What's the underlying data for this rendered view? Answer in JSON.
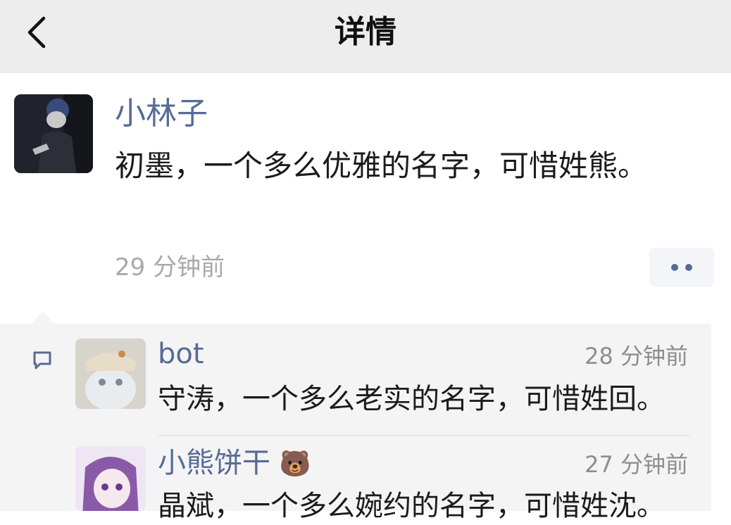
{
  "navbar": {
    "title": "详情"
  },
  "post": {
    "author": "小林子",
    "text": "初墨，一个多么优雅的名字，可惜姓熊。",
    "time": "29 分钟前"
  },
  "comments": [
    {
      "author": "bot",
      "time": "28 分钟前",
      "text": "守涛，一个多么老实的名字，可惜姓回。"
    },
    {
      "author": "小熊饼干",
      "emoji": "🐻",
      "time": "27 分钟前",
      "text": "晶斌，一个多么婉约的名字，可惜姓沈。"
    }
  ],
  "colors": {
    "link": "#576b95",
    "navbar_bg": "#ededed",
    "comment_bg": "#f4f4f4",
    "muted": "#a9a9a9"
  },
  "icons": [
    "chevron-left-icon",
    "more-dots-icon",
    "comment-bubble-icon"
  ]
}
